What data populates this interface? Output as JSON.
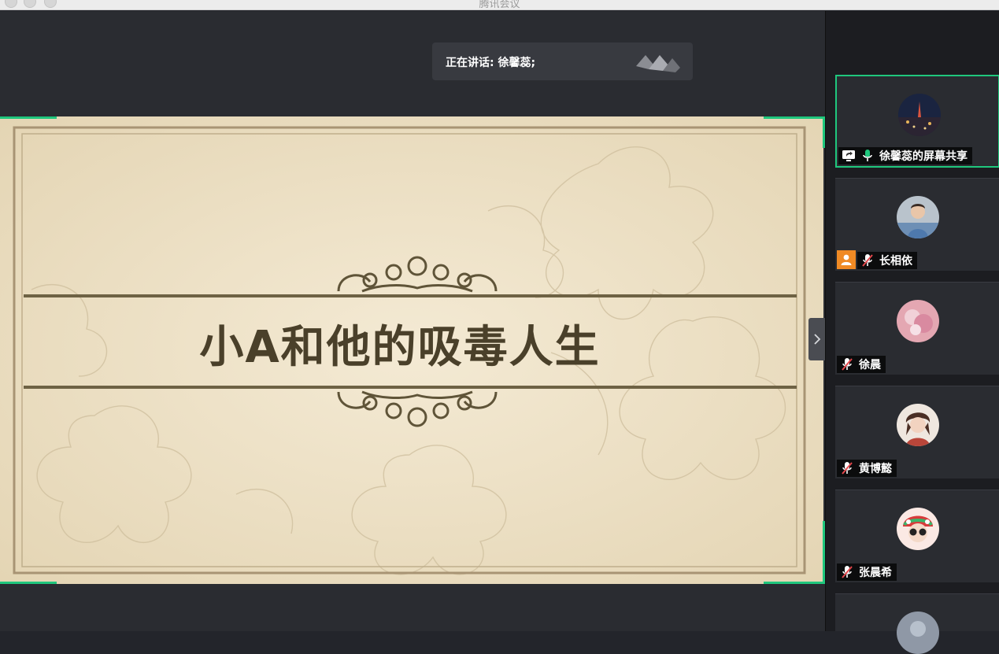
{
  "window": {
    "title": "腾讯会议"
  },
  "speaker": {
    "label": "正在讲话: 徐馨蕊;"
  },
  "slide": {
    "title": "小A和他的吸毒人生"
  },
  "colors": {
    "accent": "#1fc77d",
    "host": "#f08a24",
    "slide_bg": "#efe3c8",
    "title_text": "#4a402a"
  },
  "participants": [
    {
      "name": "徐馨蕊的屏幕共享",
      "icons": [
        "screen-share-icon",
        "mic-on-icon"
      ],
      "active": true
    },
    {
      "name": "长相依",
      "icons": [
        "mic-muted-icon"
      ],
      "host": true
    },
    {
      "name": "徐晨",
      "icons": [
        "mic-muted-icon"
      ]
    },
    {
      "name": "黄博懿",
      "icons": [
        "mic-muted-icon"
      ]
    },
    {
      "name": "张晨希",
      "icons": [
        "mic-muted-icon"
      ]
    }
  ]
}
